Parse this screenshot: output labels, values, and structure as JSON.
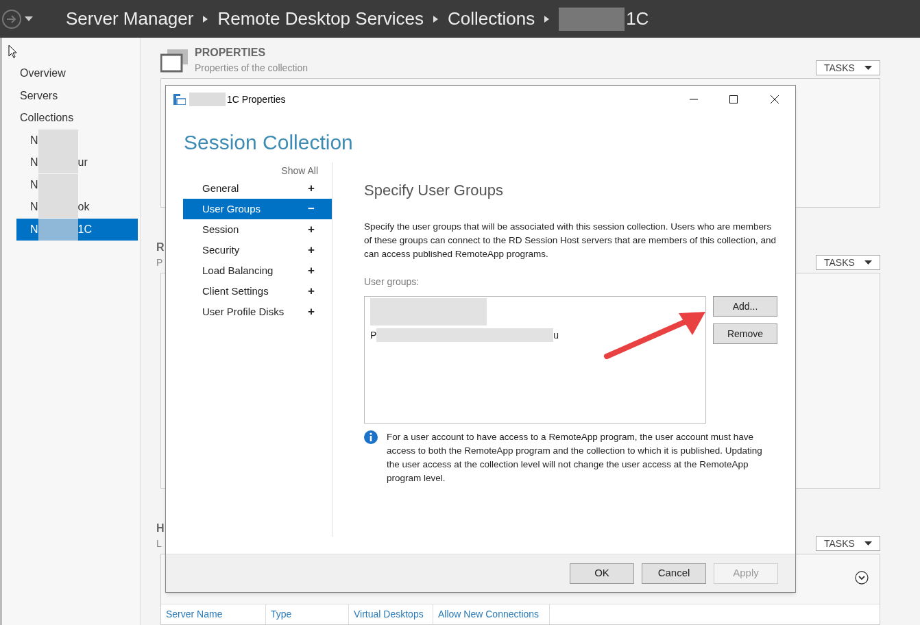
{
  "breadcrumb": [
    {
      "label": "Server Manager"
    },
    {
      "label": "Remote Desktop Services"
    },
    {
      "label": "Collections"
    },
    {
      "label": "1C",
      "redacted": true
    }
  ],
  "sidebar": {
    "items": [
      {
        "label": "Overview",
        "selected": false
      },
      {
        "label": "Servers",
        "selected": false
      },
      {
        "label": "Collections",
        "selected": false,
        "children": [
          {
            "prefix": "N",
            "selected": false
          },
          {
            "prefix": "N",
            "suffix": "ur",
            "selected": false
          },
          {
            "prefix": "N",
            "selected": false
          },
          {
            "prefix": "N",
            "suffix": "ok",
            "selected": false
          },
          {
            "prefix": "N",
            "suffix": "1C",
            "selected": true
          }
        ]
      }
    ]
  },
  "sections": [
    {
      "title": "PROPERTIES",
      "subtitle": "Properties of the collection",
      "tasks": "TASKS"
    },
    {
      "title": "R",
      "subtitle": "P",
      "tasks": "TASKS"
    },
    {
      "title": "H",
      "subtitle": "L",
      "tasks": "TASKS",
      "table": {
        "columns": [
          "Server Name",
          "Type",
          "Virtual Desktops",
          "Allow New Connections"
        ]
      }
    }
  ],
  "dialog": {
    "title": "1C Properties",
    "heading": "Session Collection",
    "show_all": "Show All",
    "nav": [
      {
        "label": "General",
        "toggle": "+",
        "selected": false
      },
      {
        "label": "User Groups",
        "toggle": "−",
        "selected": true
      },
      {
        "label": "Session",
        "toggle": "+",
        "selected": false
      },
      {
        "label": "Security",
        "toggle": "+",
        "selected": false
      },
      {
        "label": "Load Balancing",
        "toggle": "+",
        "selected": false
      },
      {
        "label": "Client Settings",
        "toggle": "+",
        "selected": false
      },
      {
        "label": "User Profile Disks",
        "toggle": "+",
        "selected": false
      }
    ],
    "page_title": "Specify User Groups",
    "description": "Specify the user groups that will be associated with this session collection. Users who are members of these groups can connect to the RD Session Host servers that are members of this collection, and can access published RemoteApp programs.",
    "list_label": "User groups:",
    "groups": [
      {
        "kind": "hidden"
      },
      {
        "kind": "partial",
        "prefix": "P",
        "suffix": "u"
      }
    ],
    "side_buttons": [
      {
        "label": "Add...",
        "disabled": false
      },
      {
        "label": "Remove",
        "disabled": false
      }
    ],
    "note": "For a user account to have access to a RemoteApp program, the user account must have access to both the RemoteApp program and the collection to which it is published. Updating the user access at the collection level will not change the user access at the RemoteApp program level.",
    "footer_buttons": [
      {
        "label": "OK",
        "disabled": false
      },
      {
        "label": "Cancel",
        "disabled": false
      },
      {
        "label": "Apply",
        "disabled": true
      }
    ]
  }
}
